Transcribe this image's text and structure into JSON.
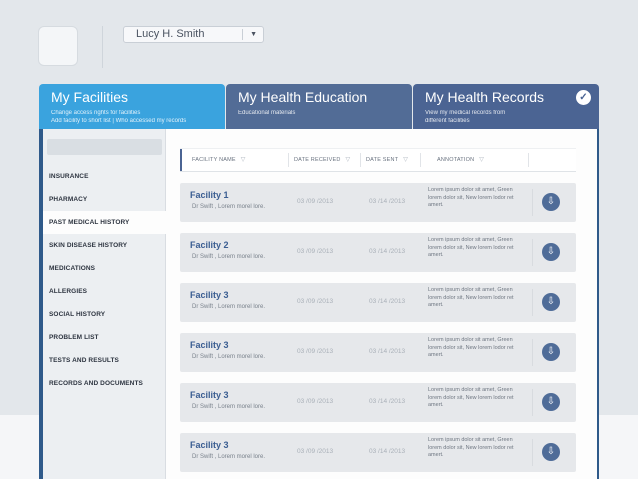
{
  "user": {
    "name": "Lucy H. Smith"
  },
  "tabs": [
    {
      "title": "My Facilities",
      "sub1": "Change access rights for facilities",
      "sub2": "Add facility to short list | Who accessed my records"
    },
    {
      "title": "My Health Education",
      "sub1": "Educational materials",
      "sub2": ""
    },
    {
      "title": "My Health Records",
      "sub1": "View my medical records from",
      "sub2": "different facilities"
    }
  ],
  "sidebar": {
    "items": [
      {
        "label": "INSURANCE"
      },
      {
        "label": "PHARMACY"
      },
      {
        "label": "PAST MEDICAL HISTORY"
      },
      {
        "label": "SKIN DISEASE HISTORY"
      },
      {
        "label": "MEDICATIONS"
      },
      {
        "label": "ALLERGIES"
      },
      {
        "label": "SOCIAL HISTORY"
      },
      {
        "label": "PROBLEM LIST"
      },
      {
        "label": "TESTS AND RESULTS"
      },
      {
        "label": "RECORDS AND DOCUMENTS"
      }
    ],
    "active_index": 2
  },
  "table": {
    "headers": [
      "FACILITY NAME",
      "DATE RECEIVED",
      "DATE SENT",
      "ANNOTATION"
    ],
    "rows": [
      {
        "name": "Facility 1",
        "doctor": "Dr Swift , Lorem morel lore.",
        "received": "03 /09 /2013",
        "sent": "03 /14 /2013",
        "note": "Lorem ipsum dolor sit amet, Green lorem dolor sit, New lorem lodor ret amert."
      },
      {
        "name": "Facility 2",
        "doctor": "Dr Swift , Lorem morel lore.",
        "received": "03 /09 /2013",
        "sent": "03 /14 /2013",
        "note": "Lorem ipsum dolor sit amet, Green lorem dolor sit, New lorem lodor ret amert."
      },
      {
        "name": "Facility 3",
        "doctor": "Dr Swift , Lorem morel lore.",
        "received": "03 /09 /2013",
        "sent": "03 /14 /2013",
        "note": "Lorem ipsum dolor sit amet, Green lorem dolor sit, New lorem lodor ret amert."
      },
      {
        "name": "Facility 3",
        "doctor": "Dr Swift , Lorem morel lore.",
        "received": "03 /09 /2013",
        "sent": "03 /14 /2013",
        "note": "Lorem ipsum dolor sit amet, Green lorem dolor sit, New lorem lodor ret amert."
      },
      {
        "name": "Facility 3",
        "doctor": "Dr Swift , Lorem morel lore.",
        "received": "03 /09 /2013",
        "sent": "03 /14 /2013",
        "note": "Lorem ipsum dolor sit amet, Green lorem dolor sit, New lorem lodor ret amert."
      },
      {
        "name": "Facility 3",
        "doctor": "Dr Swift , Lorem morel lore.",
        "received": "03 /09 /2013",
        "sent": "03 /14 /2013",
        "note": "Lorem ipsum dolor sit amet, Green lorem dolor sit, New lorem lodor ret amert."
      }
    ]
  },
  "icons": {
    "check": "check-icon",
    "download": "download-icon",
    "filter": "filter-icon",
    "dropdown": "chevron-down-icon"
  },
  "colors": {
    "facilities_tab": "#3aa3de",
    "education_tab": "#526c96",
    "records_tab": "#4b6493",
    "facility_name": "#3a5d91"
  }
}
